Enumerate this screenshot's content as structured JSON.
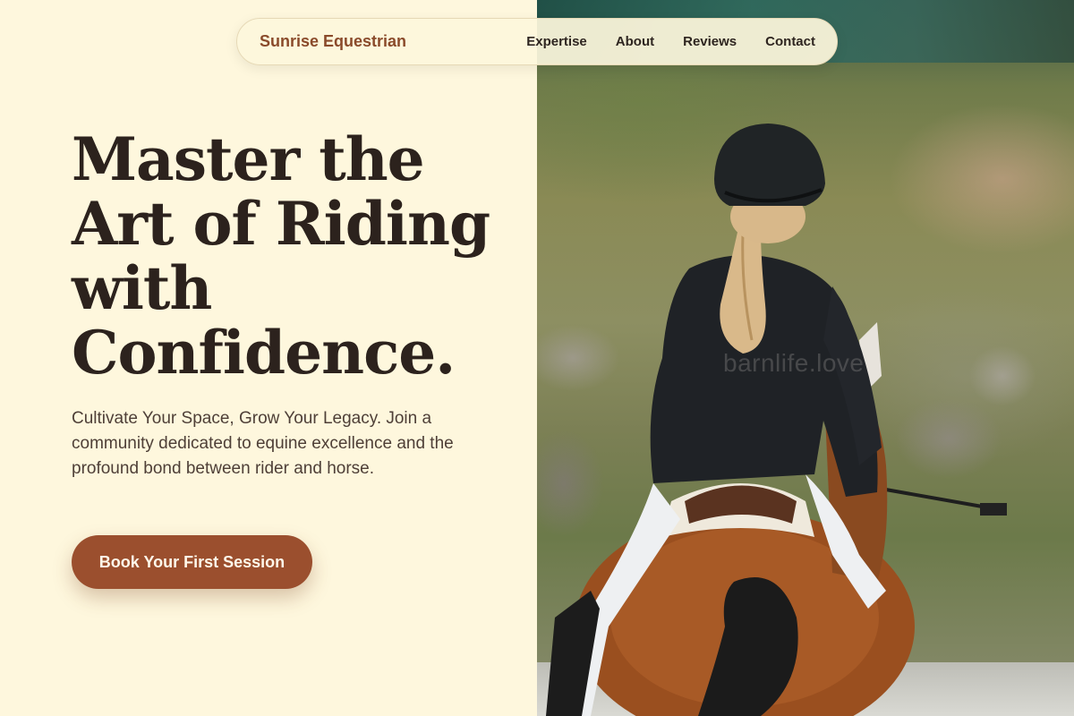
{
  "nav": {
    "brand": "Sunrise Equestrian",
    "links": [
      "Expertise",
      "About",
      "Reviews",
      "Contact"
    ]
  },
  "hero": {
    "title_lines": [
      "Master the",
      "Art of Riding",
      "with",
      "Confidence."
    ],
    "subtitle": "Cultivate Your Space, Grow Your Legacy. Join a community dedicated to equine excellence and the profound bond between rider and horse.",
    "cta_label": "Book Your First Session"
  },
  "photo": {
    "watermark": "barnlife.love",
    "subject": "rider-on-horse-photo"
  },
  "colors": {
    "background": "#fef7dd",
    "brand": "#8a4a2a",
    "accent": "#9b4f2e",
    "heading": "#2c221d",
    "body_text": "#4e3f37"
  }
}
